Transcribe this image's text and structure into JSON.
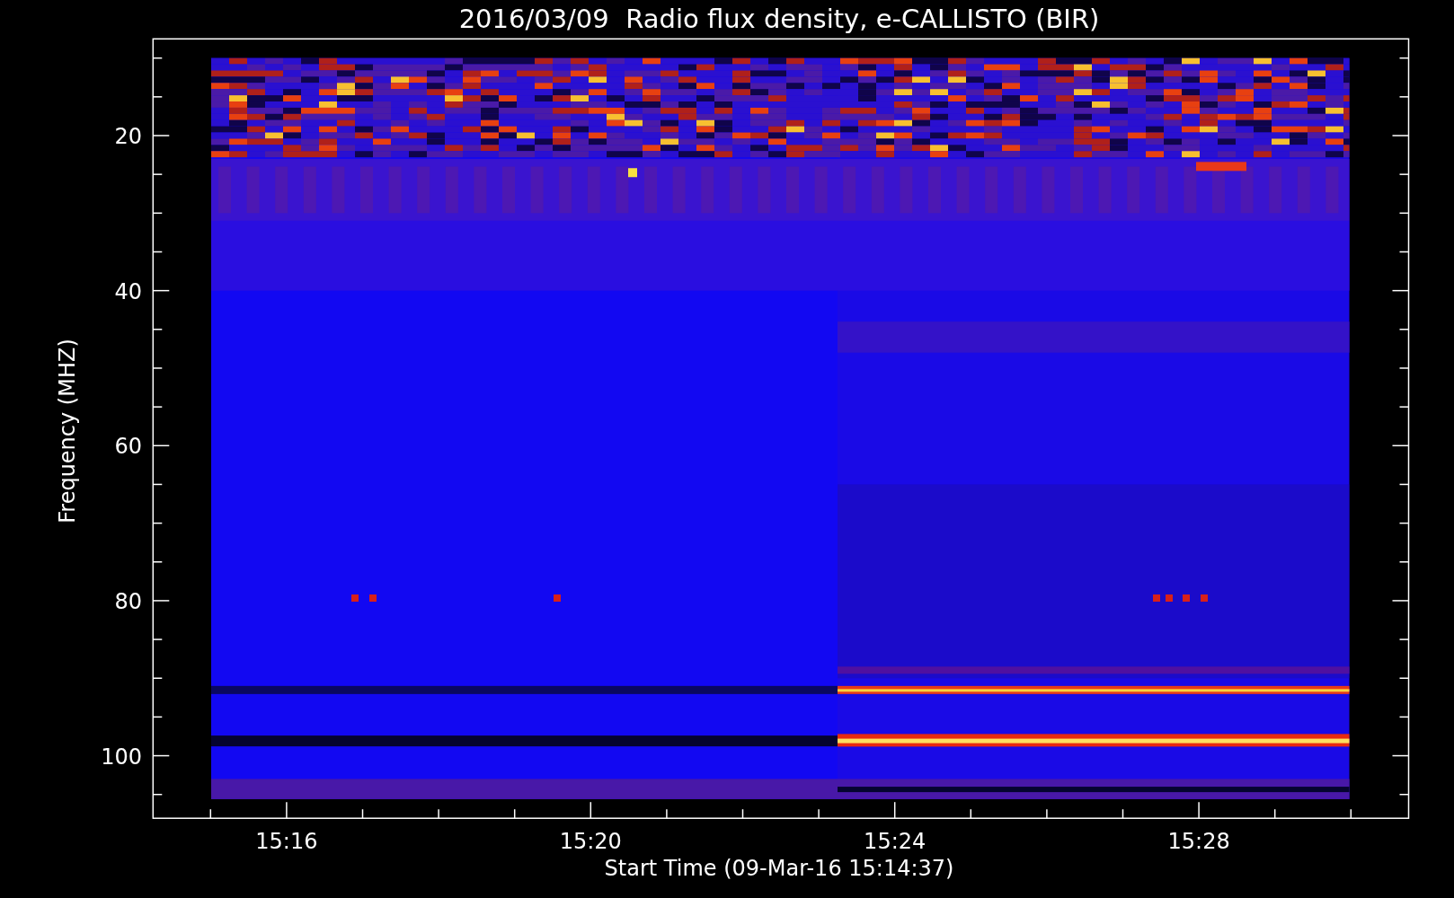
{
  "title": "2016/03/09  Radio flux density, e-CALLISTO (BIR)",
  "y_axis": {
    "label": "Frequency (MHZ)",
    "ticks": [
      "20",
      "40",
      "60",
      "80",
      "100"
    ]
  },
  "x_axis": {
    "label": "Start Time (09-Mar-16 15:14:37)",
    "ticks": [
      "15:16",
      "15:20",
      "15:24",
      "15:28"
    ]
  }
}
